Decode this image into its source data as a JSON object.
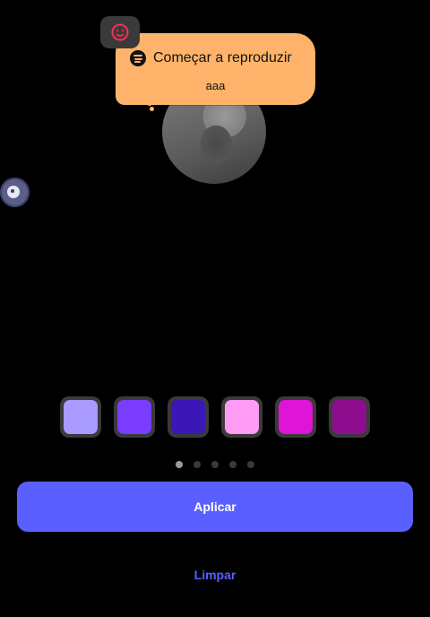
{
  "tooltip": {
    "service_icon": "spotify-icon",
    "title": "Começar a reproduzir",
    "subtitle": "aaa"
  },
  "top_badge": {
    "icon": "emoji-icon",
    "icon_color": "#ff2d55"
  },
  "swatches": [
    {
      "name": "lavender",
      "color": "#a99bff"
    },
    {
      "name": "violet",
      "color": "#7a3cff"
    },
    {
      "name": "indigo",
      "color": "#3b17b8"
    },
    {
      "name": "pink",
      "color": "#ff9bf5"
    },
    {
      "name": "magenta",
      "color": "#de14d6"
    },
    {
      "name": "purple",
      "color": "#8e0d8e"
    }
  ],
  "pagination": {
    "total": 5,
    "current": 1
  },
  "actions": {
    "apply_label": "Aplicar",
    "clear_label": "Limpar"
  },
  "colors": {
    "accent": "#5a60ff",
    "bubble": "#ffb36a",
    "background": "#000000"
  }
}
